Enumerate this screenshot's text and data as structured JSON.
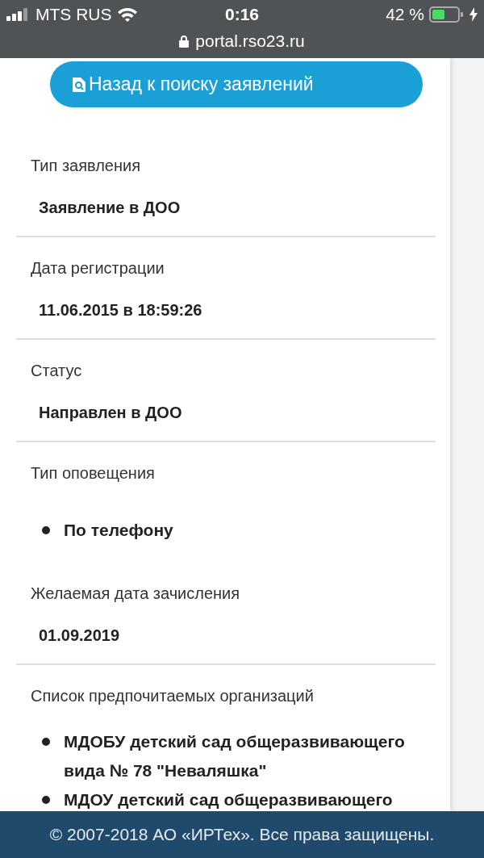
{
  "status_bar": {
    "carrier": "MTS RUS",
    "time": "0:16",
    "battery": "42 %",
    "url": "portal.rso23.ru"
  },
  "back_button": {
    "label": "Назад к поиску заявлений"
  },
  "sections": [
    {
      "kind": "value",
      "label": "Тип заявления",
      "value": "Заявление в ДОО"
    },
    {
      "kind": "value",
      "label": "Дата регистрации",
      "value": "11.06.2015 в 18:59:26"
    },
    {
      "kind": "value",
      "label": "Статус",
      "value": "Направлен в ДОО"
    },
    {
      "kind": "list",
      "label": "Тип оповещения",
      "items": [
        "По телефону"
      ]
    },
    {
      "kind": "value",
      "label": "Желаемая дата зачисления",
      "value": "01.09.2019"
    },
    {
      "kind": "list",
      "label": "Список предпочитаемых организаций",
      "items": [
        "МДОБУ детский сад общеразвивающего вида № 78 \"Неваляшка\"",
        "МДОУ детский сад общеразвивающего"
      ]
    }
  ],
  "footer": "© 2007-2018 АО «ИРТех». Все права защищены."
}
